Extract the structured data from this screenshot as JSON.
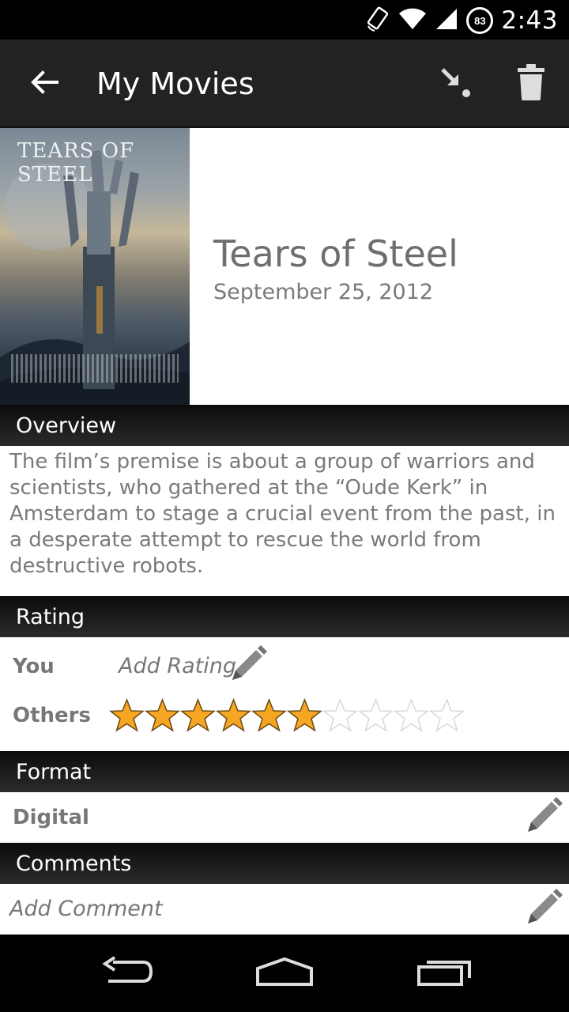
{
  "status_bar": {
    "time": "2:43",
    "battery_level": "83",
    "icons": [
      "rotate-icon",
      "wifi-icon",
      "signal-icon",
      "battery-icon"
    ]
  },
  "action_bar": {
    "title": "My Movies",
    "icons": [
      "back-arrow-icon",
      "move-to-icon",
      "trash-icon"
    ]
  },
  "movie": {
    "poster_title": "TEARS OF STEEL",
    "title": "Tears of Steel",
    "release_date": "September 25, 2012"
  },
  "overview": {
    "header": "Overview",
    "text": "The film’s premise is about a group of warriors and scientists, who gathered at the “Oude Kerk” in Amsterdam to stage a crucial event from the past, in a desperate attempt to rescue the world from destructive robots."
  },
  "rating": {
    "header": "Rating",
    "you_label": "You",
    "add_rating": "Add Rating",
    "others_label": "Others",
    "others_stars": 6,
    "max_stars": 10
  },
  "format": {
    "header": "Format",
    "value": "Digital"
  },
  "comments": {
    "header": "Comments",
    "add_comment": "Add Comment"
  },
  "colors": {
    "star_fill": "#f6a623",
    "accent_dark": "#222222"
  }
}
